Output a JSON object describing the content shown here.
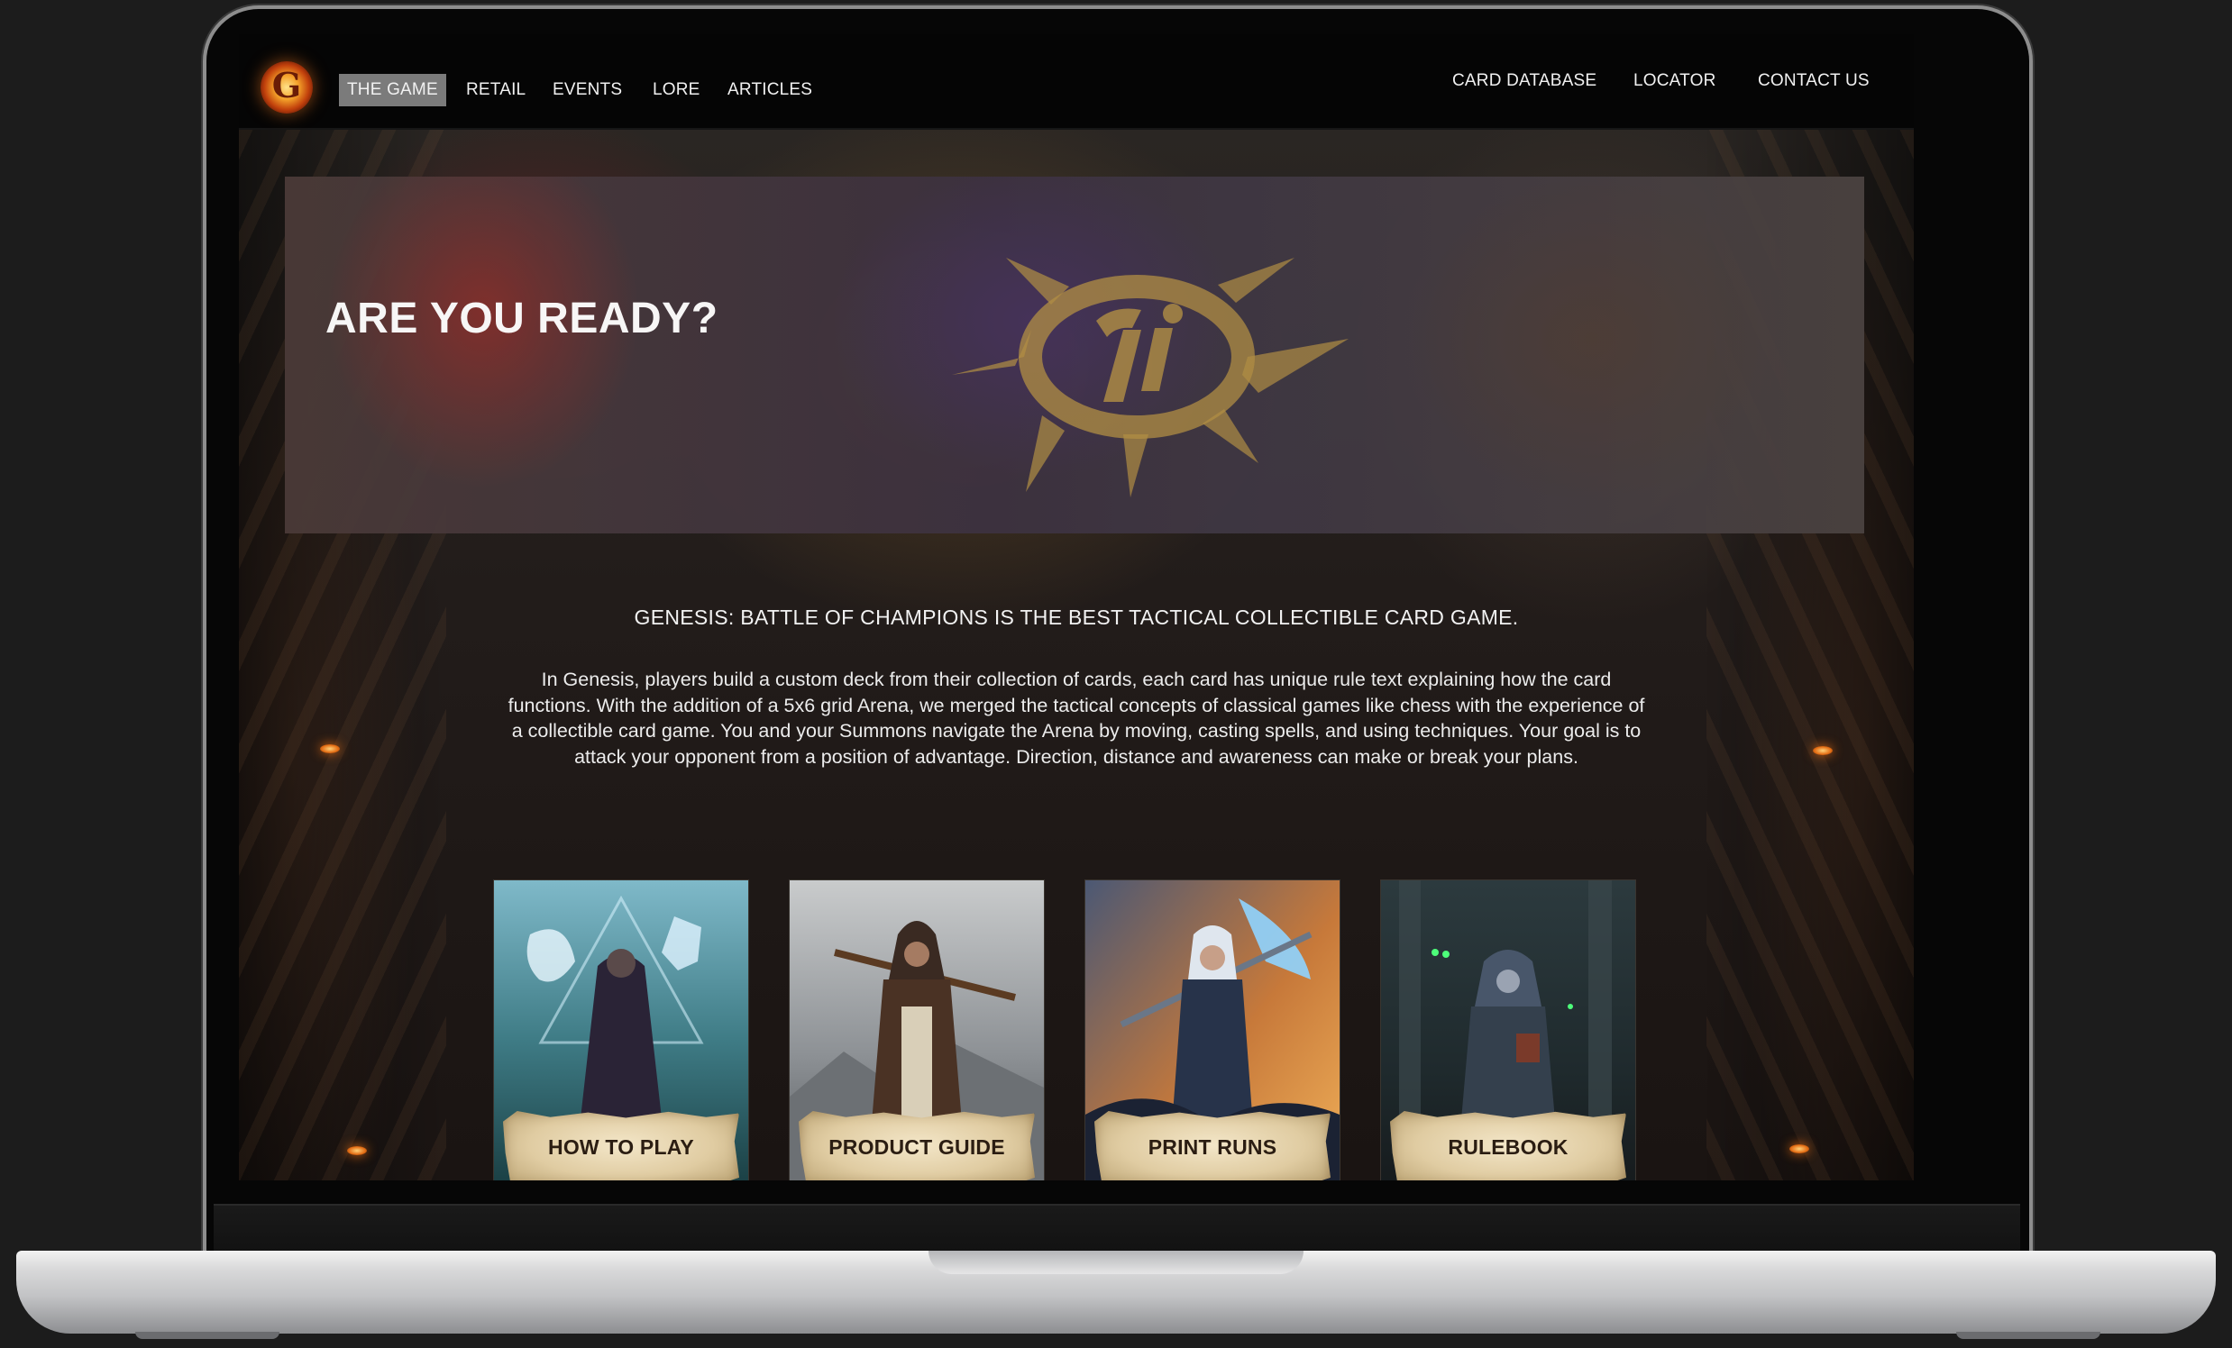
{
  "nav": {
    "left_items": [
      {
        "label": "THE GAME",
        "active": true
      },
      {
        "label": "RETAIL"
      },
      {
        "label": "EVENTS"
      },
      {
        "label": "LORE"
      },
      {
        "label": "ARTICLES"
      }
    ],
    "right_items": [
      {
        "label": "CARD DATABASE"
      },
      {
        "label": "LOCATOR"
      },
      {
        "label": "CONTACT US"
      }
    ],
    "logo": {
      "letter": "G",
      "icon": "flaming-g-logo-icon"
    }
  },
  "hero": {
    "title": "ARE YOU READY?"
  },
  "tagline": "GENESIS: BATTLE OF CHAMPIONS IS THE BEST TACTICAL COLLECTIBLE CARD GAME.",
  "intro": "In Genesis, players build a custom deck from their collection of cards, each card has unique rule text explaining how the card functions. With the addition of a 5x6 grid Arena, we merged the tactical concepts of classical games like chess with the experience of a collectible card game. You and your Summons navigate the Arena by moving, casting spells, and using techniques. Your goal is to attack your opponent from a position of advantage. Direction, distance and awareness can make or break your plans.",
  "cards": [
    {
      "label": "HOW TO PLAY",
      "art": "mage-with-spirit-wolf-art"
    },
    {
      "label": "PRODUCT GUIDE",
      "art": "hooded-archer-art"
    },
    {
      "label": "PRINT RUNS",
      "art": "ice-warrior-art"
    },
    {
      "label": "RULEBOOK",
      "art": "hooded-reader-art"
    }
  ],
  "colors": {
    "nav_active_bg": "#7b7b7b",
    "accent_gold": "#c7a24e",
    "parchment": "#e8d8b4"
  }
}
